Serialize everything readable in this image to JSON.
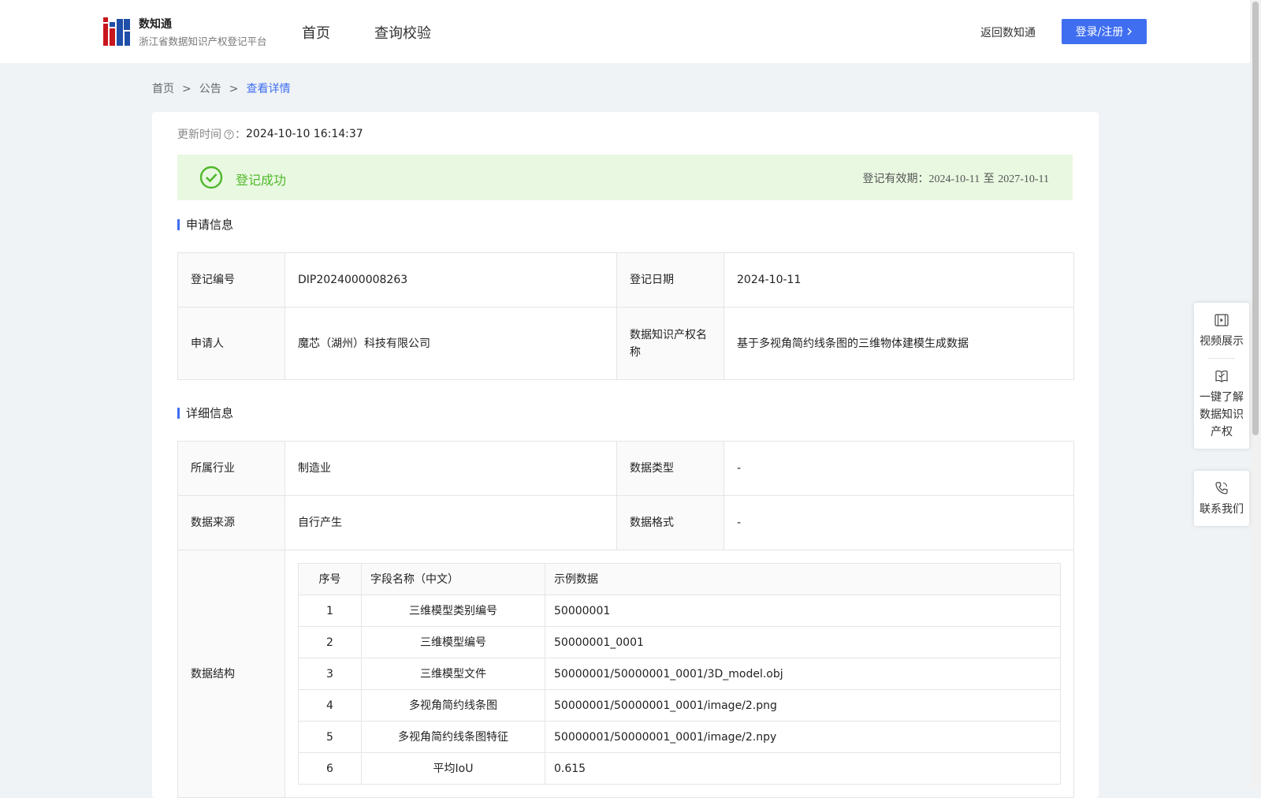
{
  "header": {
    "brand_name": "数知通",
    "brand_sub": "浙江省数据知识产权登记平台",
    "nav": [
      "首页",
      "查询校验"
    ],
    "back_link": "返回数知通",
    "login_label": "登录/注册"
  },
  "breadcrumb": [
    "首页",
    "公告",
    "查看详情"
  ],
  "update": {
    "label": "更新时间",
    "colon": "：",
    "value": "2024-10-10 16:14:37"
  },
  "status": {
    "text": "登记成功",
    "validity_label": "登记有效期：",
    "validity_start": "2024-10-11",
    "validity_to": "至",
    "validity_end": "2027-10-11",
    "color": "#4fb82b"
  },
  "application": {
    "title": "申请信息",
    "reg_no_label": "登记编号",
    "reg_no": "DIP2024000008263",
    "reg_date_label": "登记日期",
    "reg_date": "2024-10-11",
    "applicant_label": "申请人",
    "applicant": "魔芯（湖州）科技有限公司",
    "ip_name_label": "数据知识产权名称",
    "ip_name": "基于多视角简约线条图的三维物体建模生成数据"
  },
  "detail": {
    "title": "详细信息",
    "industry_label": "所属行业",
    "industry": "制造业",
    "data_type_label": "数据类型",
    "data_type": "-",
    "source_label": "数据来源",
    "source": "自行产生",
    "format_label": "数据格式",
    "format": "-",
    "structure_label": "数据结构"
  },
  "structure": {
    "headers": [
      "序号",
      "字段名称（中文）",
      "示例数据"
    ],
    "rows": [
      {
        "no": "1",
        "name": "三维模型类别编号",
        "sample": "50000001"
      },
      {
        "no": "2",
        "name": "三维模型编号",
        "sample": "50000001_0001"
      },
      {
        "no": "3",
        "name": "三维模型文件",
        "sample": "50000001/50000001_0001/3D_model.obj"
      },
      {
        "no": "4",
        "name": "多视角简约线条图",
        "sample": "50000001/50000001_0001/image/2.png"
      },
      {
        "no": "5",
        "name": "多视角简约线条图特征",
        "sample": "50000001/50000001_0001/image/2.npy"
      },
      {
        "no": "6",
        "name": "平均IoU",
        "sample": "0.615"
      }
    ]
  },
  "float_panel": {
    "video": "视频展示",
    "learn": "一键了解数据知识产权",
    "contact": "联系我们"
  },
  "colors": {
    "accent": "#3f6ef0",
    "success": "#4fb82b",
    "success_bg": "#e9f8e1"
  }
}
